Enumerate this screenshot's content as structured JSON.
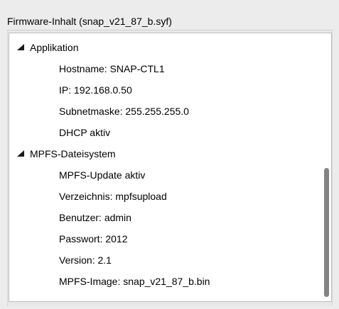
{
  "groupbox": {
    "title": "Firmware-Inhalt (snap_v21_87_b.syf)"
  },
  "tree": {
    "nodes": [
      {
        "label": "Applikation",
        "expanded": true,
        "children": [
          "Hostname: SNAP-CTL1",
          "IP: 192.168.0.50",
          "Subnetmaske: 255.255.255.0",
          "DHCP aktiv"
        ]
      },
      {
        "label": "MPFS-Dateisystem",
        "expanded": true,
        "children": [
          "MPFS-Update aktiv",
          "Verzeichnis: mpfsupload",
          "Benutzer: admin",
          "Passwort: 2012",
          "Version: 2.1",
          "MPFS-Image: snap_v21_87_b.bin"
        ]
      }
    ]
  },
  "colors": {
    "window_bg": "#ececec",
    "tree_bg": "#ffffff",
    "scroll_thumb": "#838383"
  }
}
